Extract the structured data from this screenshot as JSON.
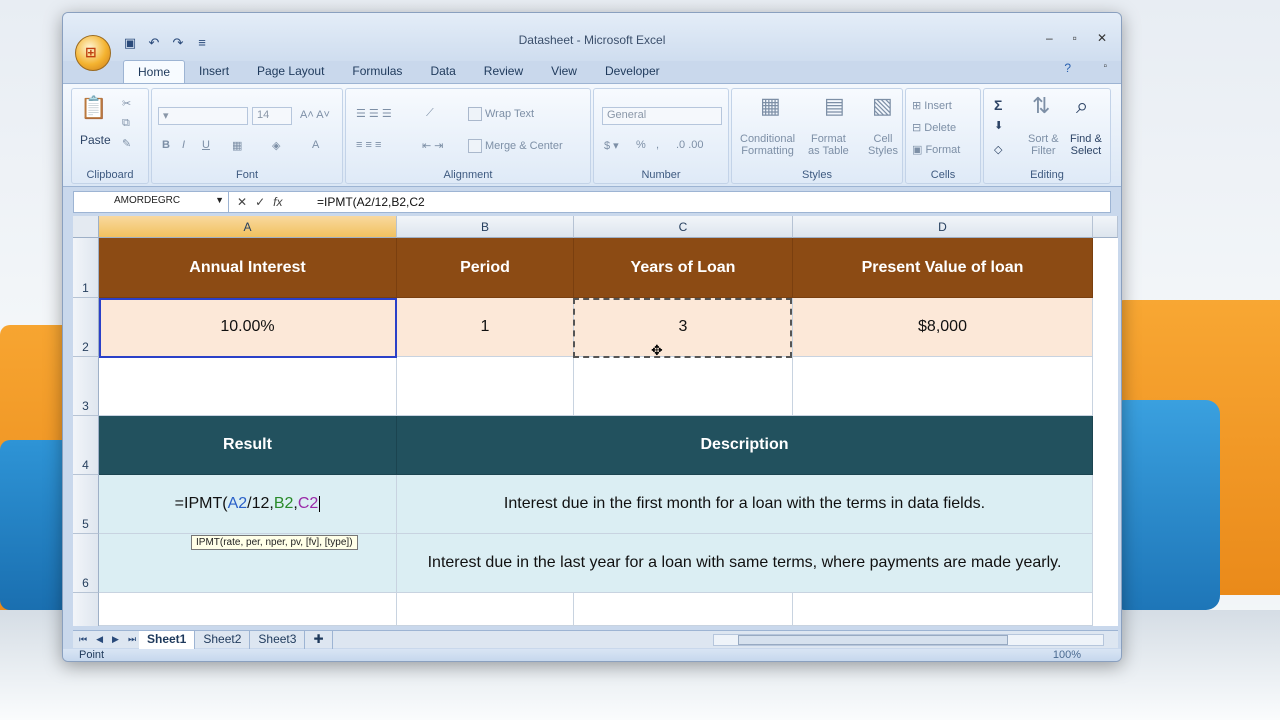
{
  "window": {
    "title": "Datasheet - Microsoft Excel"
  },
  "ribbon_tabs": [
    "Home",
    "Insert",
    "Page Layout",
    "Formulas",
    "Data",
    "Review",
    "View",
    "Developer"
  ],
  "ribbon": {
    "clipboard": {
      "label": "Clipboard",
      "paste": "Paste"
    },
    "font": {
      "label": "Font",
      "size": "14"
    },
    "alignment": {
      "label": "Alignment",
      "wrap": "Wrap Text",
      "merge": "Merge & Center"
    },
    "number": {
      "label": "Number",
      "format": "General"
    },
    "styles": {
      "label": "Styles",
      "cond1": "Conditional",
      "cond2": "Formatting",
      "fmt1": "Format",
      "fmt2": "as Table",
      "cell1": "Cell",
      "cell2": "Styles"
    },
    "cells": {
      "label": "Cells",
      "insert": "Insert",
      "delete": "Delete",
      "format": "Format"
    },
    "editing": {
      "label": "Editing",
      "sort1": "Sort &",
      "sort2": "Filter",
      "find1": "Find &",
      "find2": "Select"
    }
  },
  "formula_bar": {
    "name_box": "AMORDEGRC",
    "formula": "=IPMT(A2/12,B2,C2"
  },
  "columns": [
    "A",
    "B",
    "C",
    "D"
  ],
  "rows": [
    "1",
    "2",
    "3",
    "4",
    "5",
    "6"
  ],
  "table1": {
    "headers": [
      "Annual Interest",
      "Period",
      "Years of Loan",
      "Present Value of loan"
    ],
    "values": [
      "10.00%",
      "1",
      "3",
      "$8,000"
    ]
  },
  "table2": {
    "headers": [
      "Result",
      "Description"
    ],
    "row5": {
      "formula_prefix": "=IPMT(",
      "ref_a": "A2",
      "mid1": "/12,",
      "ref_b": "B2",
      "comma": ",",
      "ref_c": "C2",
      "desc": "Interest due in the first month for a loan with the terms in data fields."
    },
    "row6": {
      "desc": "Interest due in the last year for a loan with same terms, where payments are made yearly."
    }
  },
  "tooltip": "IPMT(rate, per, nper, pv, [fv], [type])",
  "sheet_tabs": [
    "Sheet1",
    "Sheet2",
    "Sheet3"
  ],
  "status": {
    "mode": "Point",
    "zoom": "100%"
  }
}
